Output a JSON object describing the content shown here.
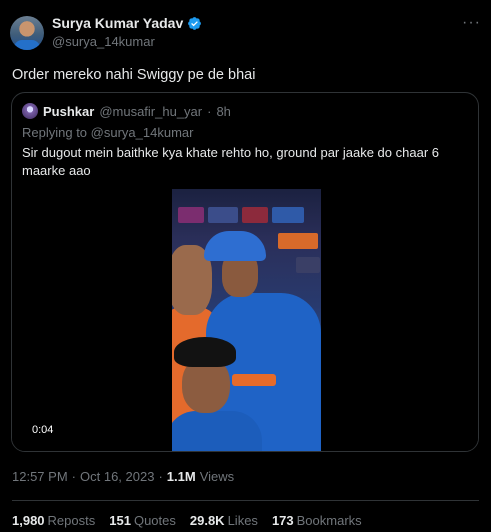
{
  "author": {
    "display_name": "Surya Kumar Yadav",
    "handle": "@surya_14kumar",
    "verified": true,
    "verified_color": "#1d9bf0"
  },
  "tweet": {
    "text": "Order mereko nahi Swiggy pe de bhai",
    "more_icon": "more-icon"
  },
  "quoted": {
    "display_name": "Pushkar",
    "handle": "@musafir_hu_yar",
    "dot": "·",
    "time": "8h",
    "replying_to_label": "Replying to",
    "replying_to_handle": "@surya_14kumar",
    "text": "Sir dugout mein baithke kya khate rehto ho, ground par jaake do chaar 6 maarke aao",
    "video_duration": "0:04"
  },
  "meta": {
    "time": "12:57 PM",
    "sep1": "·",
    "date": "Oct 16, 2023",
    "sep2": "·",
    "views": "1.1M",
    "views_label": "Views"
  },
  "stats": {
    "reposts": "1,980",
    "reposts_label": "Reposts",
    "quotes": "151",
    "quotes_label": "Quotes",
    "likes": "29.8K",
    "likes_label": "Likes",
    "bookmarks": "173",
    "bookmarks_label": "Bookmarks"
  },
  "colors": {
    "background": "#000000",
    "text_primary": "#e7e9ea",
    "text_secondary": "#71767b",
    "border": "#2f3336"
  }
}
